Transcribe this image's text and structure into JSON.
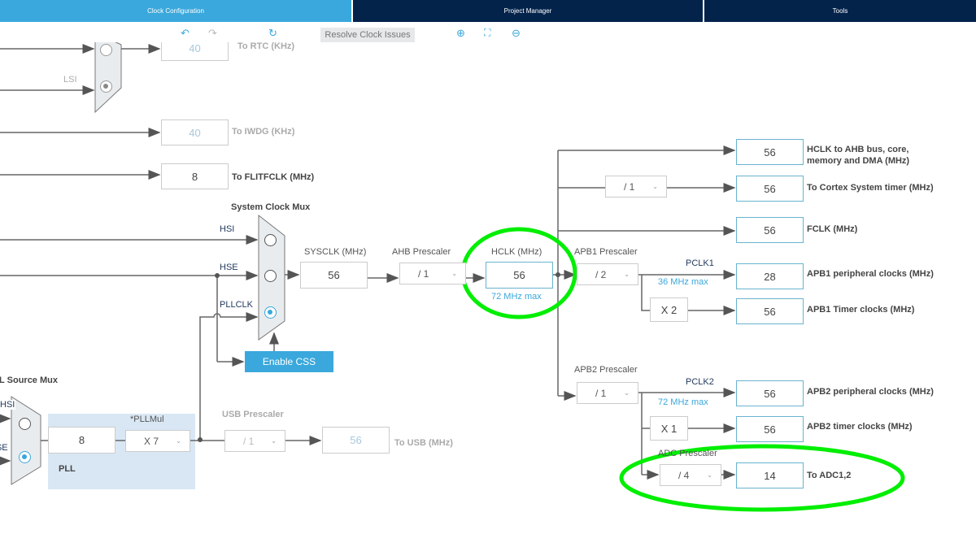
{
  "tabs": [
    {
      "label": "Clock Configuration",
      "active": true
    },
    {
      "label": "Project Manager"
    },
    {
      "label": "Tools"
    }
  ],
  "colors": {
    "active_tab": "#3aa8dc",
    "inactive_tab": "#03234b",
    "accent": "#3aa8dc",
    "highlight": "#00ee00"
  },
  "toolbar": {
    "undo": "undo-icon",
    "redo": "redo-icon",
    "refresh": "refresh-icon",
    "resolve_label": "Resolve Clock Issues",
    "zoom_in": "zoom-in-icon",
    "fit": "fit-screen-icon",
    "zoom_out": "zoom-out-icon"
  },
  "rtc": {
    "lsi_label": "LSI",
    "value": "40",
    "label": "To RTC (KHz)"
  },
  "iwdg": {
    "value": "40",
    "label": "To IWDG (KHz)"
  },
  "flitf": {
    "value": "8",
    "label": "To FLITFCLK (MHz)"
  },
  "sysmux": {
    "title": "System Clock Mux",
    "hsi": "HSI",
    "hse": "HSE",
    "pllclk": "PLLCLK",
    "selected": "PLLCLK"
  },
  "css_label": "Enable CSS",
  "sysclk": {
    "label": "SYSCLK (MHz)",
    "value": "56"
  },
  "ahb": {
    "label": "AHB Prescaler",
    "value": "/ 1"
  },
  "hclk": {
    "label": "HCLK (MHz)",
    "value": "56",
    "max": "72 MHz max"
  },
  "pllsrc": {
    "title": "PLL Source Mux",
    "hsi": "HSI",
    "hse": "HSE",
    "selected": "HSE"
  },
  "pll": {
    "input": "8",
    "mul_label": "*PLLMul",
    "mul": "X 7",
    "label": "PLL"
  },
  "usb": {
    "label": "USB Prescaler",
    "value": "/ 1",
    "out": "56",
    "out_label": "To USB (MHz)"
  },
  "outputs": {
    "ahb": {
      "value": "56",
      "label1": "HCLK to AHB bus, core,",
      "label2": "memory and DMA (MHz)"
    },
    "cortex": {
      "prescaler": "/ 1",
      "value": "56",
      "label": "To Cortex System timer (MHz)"
    },
    "fclk": {
      "value": "56",
      "label": "FCLK (MHz)"
    },
    "apb1": {
      "prescaler_label": "APB1 Prescaler",
      "prescaler": "/ 2",
      "pclk": "PCLK1",
      "max": "36 MHz max",
      "value": "28",
      "label": "APB1 peripheral clocks (MHz)",
      "timer_mul": "X 2",
      "timer_value": "56",
      "timer_label": "APB1 Timer clocks (MHz)"
    },
    "apb2": {
      "prescaler_label": "APB2 Prescaler",
      "prescaler": "/ 1",
      "pclk": "PCLK2",
      "max": "72 MHz max",
      "value": "56",
      "label": "APB2 peripheral clocks (MHz)",
      "timer_mul": "X 1",
      "timer_value": "56",
      "timer_label": "APB2 timer clocks (MHz)"
    },
    "adc": {
      "prescaler_label": "ADC Prescaler",
      "prescaler": "/ 4",
      "value": "14",
      "label": "To ADC1,2"
    }
  }
}
